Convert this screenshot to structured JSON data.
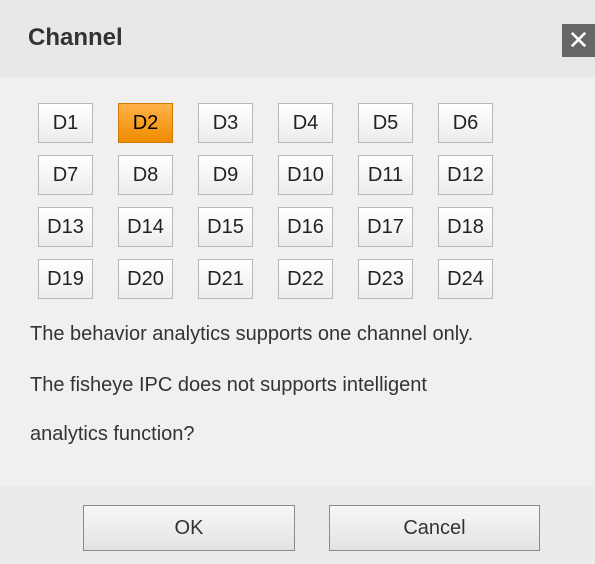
{
  "dialog": {
    "title": "Channel",
    "close_icon": "close-icon"
  },
  "channels": {
    "selected": "D2",
    "rows": [
      [
        "D1",
        "D2",
        "D3",
        "D4",
        "D5",
        "D6"
      ],
      [
        "D7",
        "D8",
        "D9",
        "D10",
        "D11",
        "D12"
      ],
      [
        "D13",
        "D14",
        "D15",
        "D16",
        "D17",
        "D18"
      ],
      [
        "D19",
        "D20",
        "D21",
        "D22",
        "D23",
        "D24"
      ]
    ]
  },
  "messages": {
    "line1": "The behavior analytics supports one channel only.",
    "line2": "The fisheye IPC does not supports intelligent",
    "line3": "analytics function?"
  },
  "footer": {
    "ok_label": "OK",
    "cancel_label": "Cancel"
  },
  "colors": {
    "selected_accent": "#f5a020",
    "close_bg": "#666666"
  }
}
